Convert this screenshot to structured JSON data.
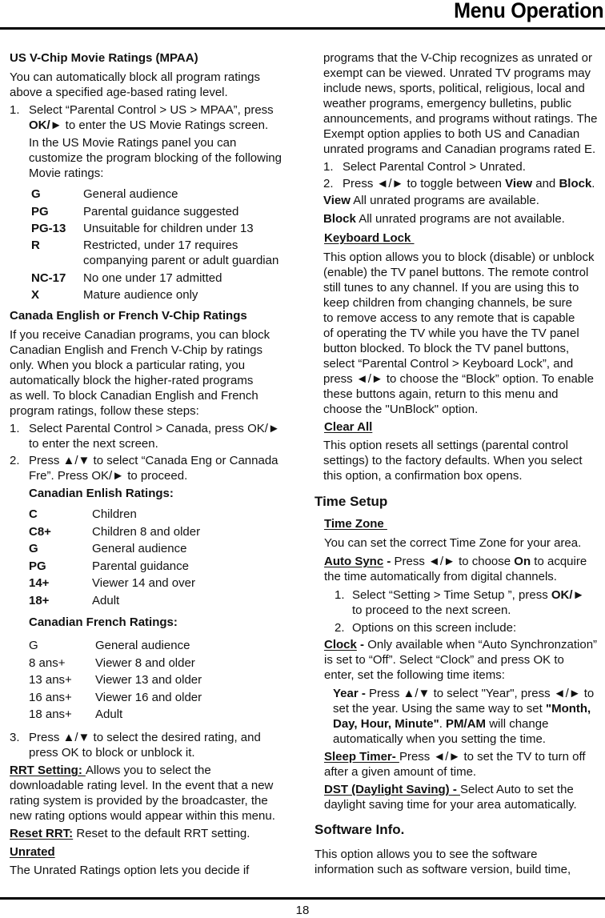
{
  "header": {
    "title": "Menu Operation"
  },
  "footer": {
    "page_number": "18"
  },
  "left": {
    "mpaa": {
      "heading": "US V-Chip Movie Ratings (MPAA)",
      "intro": [
        "You can automatically block all program ratings",
        "above a specified age-based rating level."
      ],
      "step1_num": "1.",
      "step1_line1": "Select “Parental Control > US > MPAA”, press",
      "step1_bold": "OK/►",
      "step1_line2": " to enter the US Movie Ratings screen.",
      "step1_extra": [
        "In the US Movie Ratings panel you can",
        "customize the program blocking of the following",
        "Movie ratings:"
      ],
      "ratings": [
        {
          "code": "G",
          "desc": [
            "General audience"
          ]
        },
        {
          "code": "PG",
          "desc": [
            "Parental guidance suggested"
          ]
        },
        {
          "code": "PG-13",
          "desc": [
            "Unsuitable for children under 13"
          ]
        },
        {
          "code": "R",
          "desc": [
            "Restricted, under 17 requires",
            "companying parent or adult guardian"
          ]
        },
        {
          "code": "NC-17",
          "desc": [
            "No one under 17 admitted"
          ]
        },
        {
          "code": "X",
          "desc": [
            "Mature audience only"
          ]
        }
      ]
    },
    "canada": {
      "heading": "Canada English or French V-Chip Ratings",
      "intro": [
        "If you receive Canadian programs, you can block",
        "Canadian English and French V-Chip by ratings",
        "only. When you block a particular rating, you",
        "automatically block the higher-rated programs",
        "as well. To block Canadian English and French",
        "program ratings, follow these steps:"
      ],
      "step1_num": "1.",
      "step1": [
        "Select Parental Control > Canada, press OK/►",
        "to enter the next screen."
      ],
      "step2_num": "2.",
      "step2": [
        "Press ▲/▼ to select “Canada Eng or Cannada",
        "Fre”. Press OK/► to proceed."
      ],
      "english_heading": "Canadian Enlish Ratings:",
      "english_ratings": [
        {
          "code": "C",
          "desc": "Children"
        },
        {
          "code": "C8+",
          "desc": "Children 8 and older"
        },
        {
          "code": "G",
          "desc": "General audience"
        },
        {
          "code": "PG",
          "desc": "Parental guidance"
        },
        {
          "code": "14+",
          "desc": "Viewer 14 and over"
        },
        {
          "code": "18+",
          "desc": "Adult"
        }
      ],
      "french_heading": "Canadian French Ratings:",
      "french_ratings": [
        {
          "code": "G",
          "desc": "General audience"
        },
        {
          "code": "8 ans+",
          "desc": "Viewer 8 and older"
        },
        {
          "code": "13 ans+",
          "desc": "Viewer 13 and older"
        },
        {
          "code": "16 ans+",
          "desc": "Viewer 16 and older"
        },
        {
          "code": "18 ans+",
          "desc": "Adult"
        }
      ],
      "step3_num": "3.",
      "step3": [
        "Press ▲/▼ to select the desired rating, and",
        "press OK to block or unblock it."
      ]
    },
    "rrt": {
      "label": "RRT Setting: ",
      "text_first": "Allows you to select the",
      "text": [
        "downloadable rating level. In the event that a new",
        "rating system is provided by the broadcaster, the",
        "new rating options would appear within this menu."
      ]
    },
    "reset_rrt": {
      "label": "Reset RRT:",
      "text": " Reset to the default RRT setting."
    },
    "unrated": {
      "heading": "Unrated",
      "text": "The Unrated Ratings option lets you decide if"
    }
  },
  "right": {
    "unrated_cont": [
      "programs that the V-Chip recognizes as unrated or",
      "exempt can be viewed. Unrated TV programs may",
      "include news, sports, political, religious, local and",
      "weather programs, emergency bulletins, public",
      "announcements, and programs without ratings. The",
      "Exempt option applies to both US and Canadian",
      "unrated programs and Canadian programs rated E."
    ],
    "unrated_step1_num": "1.",
    "unrated_step1": "Select Parental Control > Unrated.",
    "unrated_step2_num": "2.",
    "unrated_step2_pre": "Press ◄/► to toggle between ",
    "unrated_step2_view": "View",
    "unrated_step2_mid": " and ",
    "unrated_step2_block": "Block",
    "unrated_step2_end": ".",
    "view_label": "View",
    "view_text": " All unrated programs are available.",
    "block_label": "Block",
    "block_text": " All unrated programs are not available.",
    "keyboard_lock": {
      "heading": "Keyboard Lock ",
      "text": [
        "This option allows you to block (disable) or unblock",
        "(enable) the TV panel buttons. The remote control",
        "still tunes to any channel. If you are using this to",
        "keep children from changing channels, be sure",
        "to remove access to any remote that is capable",
        "of operating the TV while you have the TV panel",
        "button blocked. To block the TV panel buttons,",
        "select “Parental Control > Keyboard Lock”, and",
        "press ◄/► to choose the “Block” option. To enable",
        "these buttons again, return to this menu and",
        "choose the \"UnBlock\" option."
      ]
    },
    "clear_all": {
      "heading": "Clear All",
      "text": [
        "This option resets all settings (parental control",
        "settings) to the factory defaults. When you select",
        "this option, a confirmation box opens."
      ]
    },
    "time_setup": {
      "heading": "Time Setup",
      "time_zone_heading": "Time Zone ",
      "time_zone_text": "You can set the correct Time Zone for your area.",
      "auto_sync_label": "Auto Sync",
      "auto_sync_dash": " - ",
      "auto_sync_pre": "Press ◄/► to choose ",
      "auto_sync_on": "On",
      "auto_sync_post": " to acquire",
      "auto_sync_line2": "the time automatically from digital channels.",
      "step1_num": "1.",
      "step1_pre": "Select “Setting > Time Setup ”, press ",
      "step1_bold": "OK/►",
      "step1_line2": "to proceed to the next screen.",
      "step2_num": "2.",
      "step2": "Options on this screen include:",
      "clock_label": "Clock",
      "clock_dash": " - ",
      "clock_text_first": "Only available when “Auto Synchronzation”",
      "clock_text": [
        "is set to “Off”. Select “Clock” and press OK to",
        "enter, set the following time items:"
      ],
      "year_label": "Year - ",
      "year_text_first": "Press ▲/▼ to select \"Year\", press ◄/► to",
      "year_line2_pre": "set the year. Using the same way to set ",
      "year_line2_bold": "\"Month,",
      "year_line3_bold": "Day, Hour, Minute\"",
      "year_line3_mid": ". ",
      "year_line3_bold2": "PM/AM",
      "year_line3_post": " will change",
      "year_line4": "automatically when you setting the time.",
      "sleep_label": "Sleep Timer- ",
      "sleep_text": "Press ◄/► to set the TV to turn off",
      "sleep_line2": "after a given amount of time.",
      "dst_label": "DST (Daylight Saving) - ",
      "dst_text": "Select Auto to set the",
      "dst_line2": "daylight saving time for your area automatically."
    },
    "software_info": {
      "heading": "Software Info.",
      "text": [
        "This option allows you to see the software",
        "information such as software version, build time,"
      ]
    }
  }
}
